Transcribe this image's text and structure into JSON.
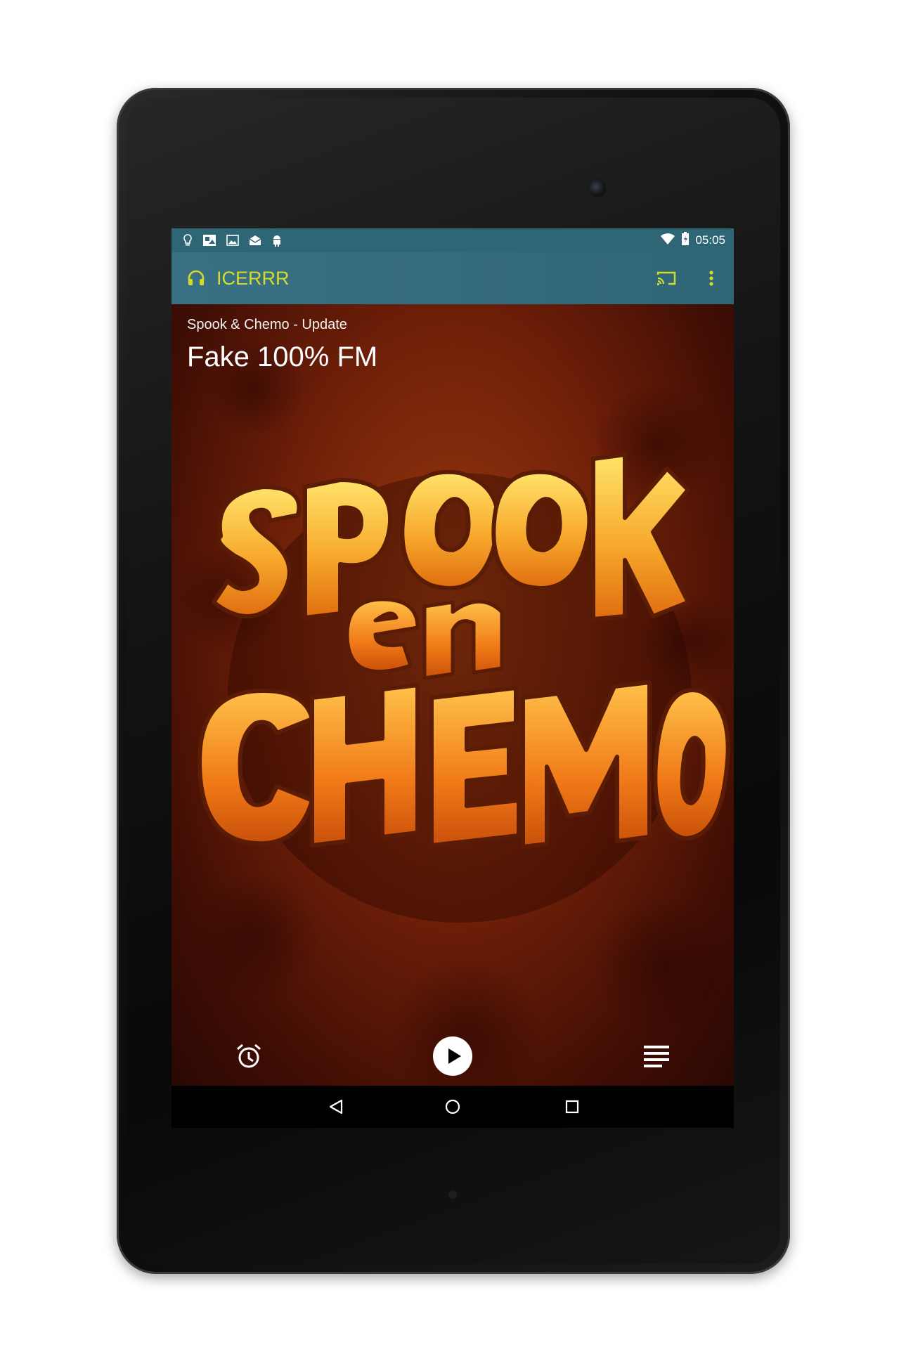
{
  "status_bar": {
    "time": "05:05",
    "notification_icons": [
      "bulb-icon",
      "gallery-icon",
      "image-icon",
      "mail-icon",
      "android-icon"
    ],
    "system_icons": [
      "wifi-icon",
      "battery-icon"
    ]
  },
  "app_bar": {
    "app_icon": "headphones-icon",
    "title": "ICERRR",
    "actions": [
      "cast-icon",
      "overflow-menu-icon"
    ],
    "accent_color": "#d4dc2a",
    "background_color": "#2f6676"
  },
  "now_playing": {
    "track": "Spook & Chemo - Update",
    "station": "Fake 100% FM",
    "artwork_text": "Spook en Chemo"
  },
  "controls": {
    "alarm": "alarm-icon",
    "play": "play-icon",
    "queue": "list-icon"
  },
  "nav_bar": {
    "buttons": [
      "back-icon",
      "home-icon",
      "recents-icon"
    ]
  }
}
